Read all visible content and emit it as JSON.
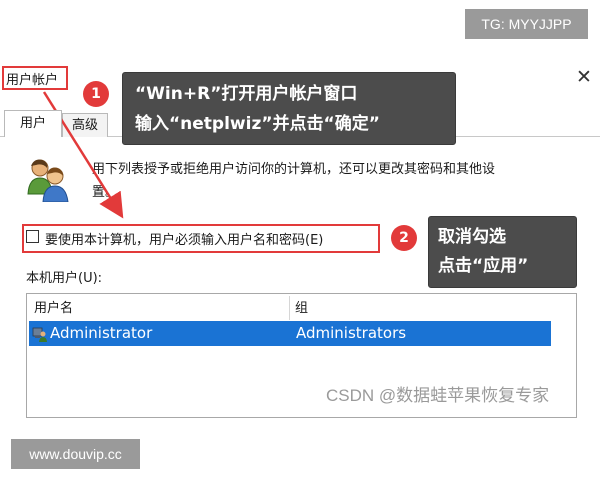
{
  "watermarks": {
    "top_right": "TG: MYYJJPP",
    "bottom_left": "www.douvip.cc",
    "csdn": "CSDN @数据蛙苹果恢复专家"
  },
  "dialog": {
    "title": "用户帐户",
    "close_glyph": "✕",
    "tabs": [
      {
        "label": "用户",
        "active": true
      },
      {
        "label": "高级",
        "active": false
      }
    ],
    "description_line1": "用下列表授予或拒绝用户访问你的计算机，还可以更改其密码和其他设",
    "description_line2": "置。",
    "checkbox": {
      "label": "要使用本计算机，用户必须输入用户名和密码(E)",
      "checked": false
    },
    "users_label": "本机用户(U):",
    "table": {
      "columns": [
        "用户名",
        "组"
      ],
      "rows": [
        {
          "user": "Administrator",
          "group": "Administrators",
          "selected": true
        }
      ]
    }
  },
  "callouts": [
    {
      "number": "1",
      "line1": "“Win+R”打开用户帐户窗口",
      "line2": "输入“netplwiz”并点击“确定”"
    },
    {
      "number": "2",
      "line1": "取消勾选",
      "line2": "点击“应用”"
    }
  ],
  "colors": {
    "highlight_red": "#e23a3a",
    "selection_blue": "#1a73d4",
    "callout_bg": "#4c4c4c"
  }
}
